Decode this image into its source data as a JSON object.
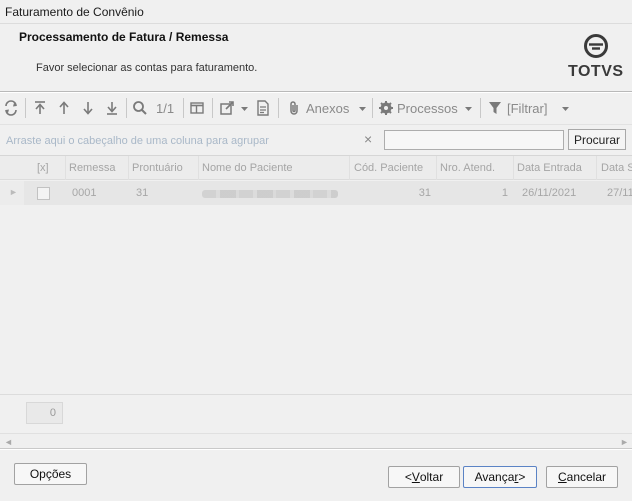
{
  "window": {
    "title": "Faturamento de Convênio"
  },
  "header": {
    "title": "Processamento de Fatura / Remessa",
    "subtitle": "Favor selecionar as contas para faturamento.",
    "logo_text": "TOTVS"
  },
  "toolbar": {
    "page_indicator": "1/1",
    "anexos_label": "Anexos",
    "processos_label": "Processos",
    "filtrar_label": "[Filtrar]"
  },
  "groupbar": {
    "hint": "Arraste aqui o cabeçalho de uma coluna para agrupar",
    "clear_symbol": "×",
    "search_value": "",
    "search_button": "Procurar"
  },
  "grid": {
    "columns": [
      "[x]",
      "Remessa",
      "Prontuário",
      "Nome do Paciente",
      "Cód. Paciente",
      "Nro. Atend.",
      "Data Entrada",
      "Data S"
    ],
    "rows": [
      {
        "remessa": "0001",
        "prontuario": "31",
        "nome": "",
        "cod_paciente": "31",
        "nro_atend": "1",
        "data_entrada": "26/11/2021",
        "data_s": "27/11"
      }
    ],
    "record_count": "0"
  },
  "buttons": {
    "opcoes": "Opções",
    "voltar_prefix": "< ",
    "voltar_key": "V",
    "voltar_rest": "oltar",
    "avancar_prefix": "Avança",
    "avancar_key": "r",
    "avancar_suffix": " >",
    "cancelar_prefix": "",
    "cancelar_key": "C",
    "cancelar_rest": "ancelar"
  },
  "colors": {
    "accent": "#5b83c5",
    "logo": "#3a3a3a"
  }
}
